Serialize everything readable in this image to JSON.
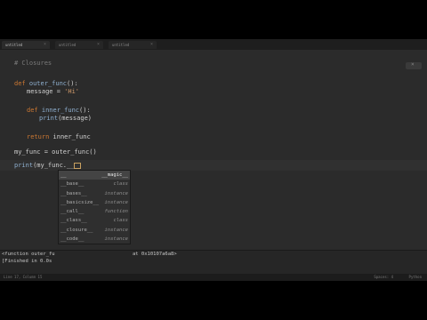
{
  "tabs": [
    {
      "label": "untitled"
    },
    {
      "label": "untitled"
    },
    {
      "label": "untitled"
    }
  ],
  "code": {
    "comment": "# Closures",
    "line_def_outer": {
      "kw": "def",
      "name": "outer_func",
      "rest": "():"
    },
    "line_message": {
      "lhs": "message = ",
      "str": "'Hi'"
    },
    "line_def_inner": {
      "kw": "def",
      "name": "inner_func",
      "rest": "():"
    },
    "line_print_msg": {
      "bi": "print",
      "rest": "(message)"
    },
    "line_return": {
      "kw": "return",
      "rest": " inner_func"
    },
    "line_assign": "my_func = outer_func()",
    "line_print_call": {
      "bi": "print",
      "rest": "(my_func.__"
    }
  },
  "autocomplete": [
    {
      "name": "__",
      "type": "__magic__"
    },
    {
      "name": "__base__",
      "type": "class"
    },
    {
      "name": "__bases__",
      "type": "instance"
    },
    {
      "name": "__basicsize__",
      "type": "instance"
    },
    {
      "name": "__call__",
      "type": "function"
    },
    {
      "name": "__class__",
      "type": "class"
    },
    {
      "name": "__closure__",
      "type": "instance"
    },
    {
      "name": "__code__",
      "type": "instance"
    }
  ],
  "output": {
    "line1_left": "<function outer_fu",
    "line1_right": "at 0x10107a6a8>",
    "line2_left": "[Finished in 0.0s"
  },
  "status": {
    "left": "Line 17, Column 15",
    "right1": "Spaces: 4",
    "right2": "Python"
  }
}
